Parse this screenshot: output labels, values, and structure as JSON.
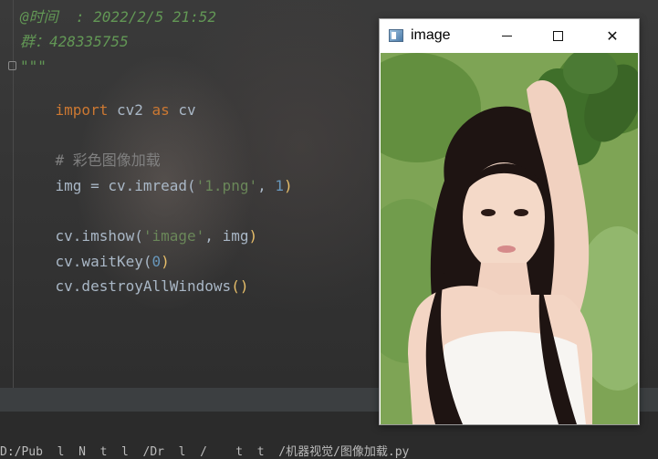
{
  "editor": {
    "lines": [
      {
        "text": "@时间  : 2022/2/5 21:52",
        "style": "doc"
      },
      {
        "text": "群：428335755",
        "style": "doc"
      },
      {
        "text": "\"\"\"",
        "style": "doc"
      },
      {
        "tokens": [
          {
            "t": "import",
            "c": "kw"
          },
          {
            "t": " cv2 ",
            "c": "id"
          },
          {
            "t": "as",
            "c": "kw"
          },
          {
            "t": " cv",
            "c": "id"
          }
        ]
      },
      {
        "tokens": [
          {
            "t": "# 彩色图像加载",
            "c": "comment"
          }
        ]
      },
      {
        "tokens": [
          {
            "t": "img = cv.imread(",
            "c": "id"
          },
          {
            "t": "'1.png'",
            "c": "str"
          },
          {
            "t": ", ",
            "c": "id"
          },
          {
            "t": "1",
            "c": "num"
          },
          {
            "t": ")",
            "c": "paren"
          }
        ]
      },
      {
        "tokens": [
          {
            "t": "cv.imshow(",
            "c": "id"
          },
          {
            "t": "'image'",
            "c": "str"
          },
          {
            "t": ", img",
            "c": "id"
          },
          {
            "t": ")",
            "c": "paren"
          }
        ]
      },
      {
        "tokens": [
          {
            "t": "cv.waitKey(",
            "c": "id"
          },
          {
            "t": "0",
            "c": "num"
          },
          {
            "t": ")",
            "c": "paren"
          }
        ]
      },
      {
        "tokens": [
          {
            "t": "cv.destroyAllWindows",
            "c": "id"
          },
          {
            "t": "()",
            "c": "paren"
          }
        ]
      }
    ]
  },
  "window": {
    "title": "image",
    "minimize_icon": "minimize-icon",
    "maximize_icon": "maximize-icon",
    "close_icon": "close-icon"
  },
  "terminal": {
    "line": "D:/Pub  l  N  t  l  /Dr  l  /    t  t  /机器视觉/图像加载.py"
  },
  "colors": {
    "keyword": "#cc7832",
    "string": "#6a8759",
    "number": "#6897bb",
    "comment": "#808080",
    "docstring": "#629755",
    "paren": "#e8bf6a"
  }
}
